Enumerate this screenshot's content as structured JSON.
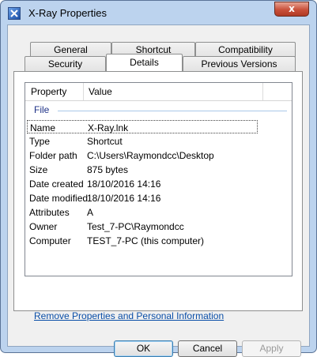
{
  "window": {
    "title": "X-Ray Properties",
    "close_glyph": "x"
  },
  "tabs_row1": [
    "General",
    "Shortcut",
    "Compatibility"
  ],
  "tabs_row2": [
    "Security",
    "Details",
    "Previous Versions"
  ],
  "active_tab": "Details",
  "list": {
    "headers": {
      "property": "Property",
      "value": "Value"
    },
    "group": "File",
    "rows": [
      {
        "property": "Name",
        "value": "X-Ray.lnk"
      },
      {
        "property": "Type",
        "value": "Shortcut"
      },
      {
        "property": "Folder path",
        "value": "C:\\Users\\Raymondcc\\Desktop"
      },
      {
        "property": "Size",
        "value": "875 bytes"
      },
      {
        "property": "Date created",
        "value": "18/10/2016 14:16"
      },
      {
        "property": "Date modified",
        "value": "18/10/2016 14:16"
      },
      {
        "property": "Attributes",
        "value": "A"
      },
      {
        "property": "Owner",
        "value": "Test_7-PC\\Raymondcc"
      },
      {
        "property": "Computer",
        "value": "TEST_7-PC (this computer)"
      }
    ]
  },
  "remove_link": "Remove Properties and Personal Information",
  "buttons": {
    "ok": "OK",
    "cancel": "Cancel",
    "apply": "Apply"
  },
  "colors": {
    "frame": "#bcd3ee",
    "link": "#0b4fa8",
    "group_header": "#1e3287"
  }
}
